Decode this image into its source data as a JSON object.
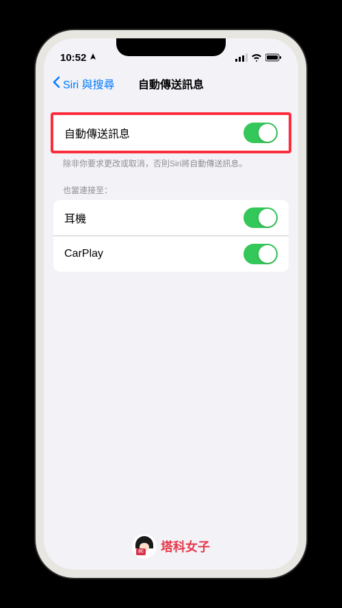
{
  "status_bar": {
    "time": "10:52"
  },
  "nav": {
    "back_label": "Siri 與搜尋",
    "title": "自動傳送訊息"
  },
  "main_toggle": {
    "label": "自動傳送訊息",
    "on": true
  },
  "footer_text": "除非你要求更改或取消，否則Siri將自動傳送訊息。",
  "section_header": "也當連接至：",
  "connection_items": [
    {
      "label": "耳機",
      "on": true
    },
    {
      "label": "CarPlay",
      "on": true
    }
  ],
  "watermark": {
    "badge": "3C",
    "text": "塔科女子"
  }
}
